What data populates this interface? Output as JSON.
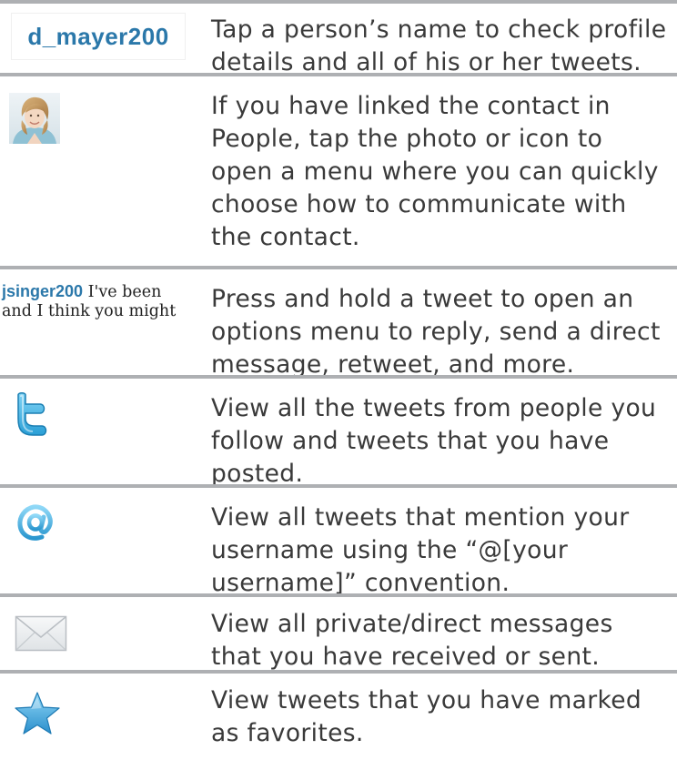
{
  "rows": [
    {
      "icon": "username-link",
      "username": "d_mayer200",
      "description": "Tap a person’s name to check profile details and all of his or her tweets."
    },
    {
      "icon": "contact-photo",
      "description": "If you have linked the contact in People, tap the photo or icon to open a menu where you can quickly choose how to communicate with the contact."
    },
    {
      "icon": "tweet-snippet",
      "tweet_user": "jsinger200",
      "tweet_text_1": " I've been",
      "tweet_text_2": "and I think you might",
      "description": "Press and hold a tweet to open an options menu to reply, send a direct message, retweet, and more."
    },
    {
      "icon": "twitter-home-icon",
      "description": "View all the tweets from people you follow and tweets that you have posted."
    },
    {
      "icon": "at-mention-icon",
      "description": "View all tweets that mention your username using the “@[your username]” convention."
    },
    {
      "icon": "envelope-icon",
      "description": "View all private/direct messages that you have received or sent."
    },
    {
      "icon": "star-icon",
      "description": "View tweets that you have marked as favorites."
    }
  ],
  "colors": {
    "divider": "#aeb0b3",
    "text": "#3a3a3a",
    "link": "#2b78aa"
  }
}
